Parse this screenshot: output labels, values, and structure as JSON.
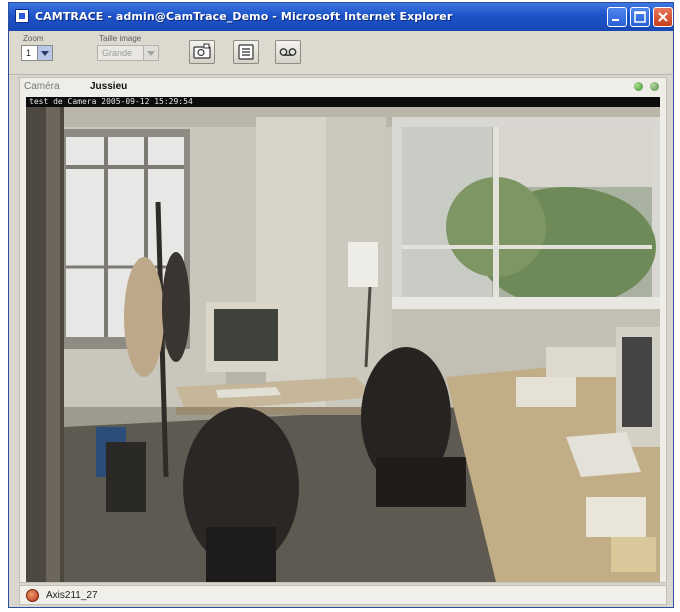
{
  "window": {
    "title": "CAMTRACE - admin@CamTrace_Demo - Microsoft Internet Explorer"
  },
  "toolbar": {
    "zoom_label": "Zoom",
    "zoom_value": "1",
    "size_label": "Taille image",
    "size_value": "Grande"
  },
  "camera": {
    "label": "Caméra",
    "name": "Jussieu",
    "osd_text": "test de Camera 2005-09-12 15:29:54",
    "status_colors": [
      "#4caf3a",
      "#5a9a46"
    ]
  },
  "status": {
    "text": "Axis211_27"
  },
  "icons": {
    "toolbar": [
      "snapshot-icon",
      "menu-list-icon",
      "record-icon"
    ],
    "status": "stop-icon"
  }
}
